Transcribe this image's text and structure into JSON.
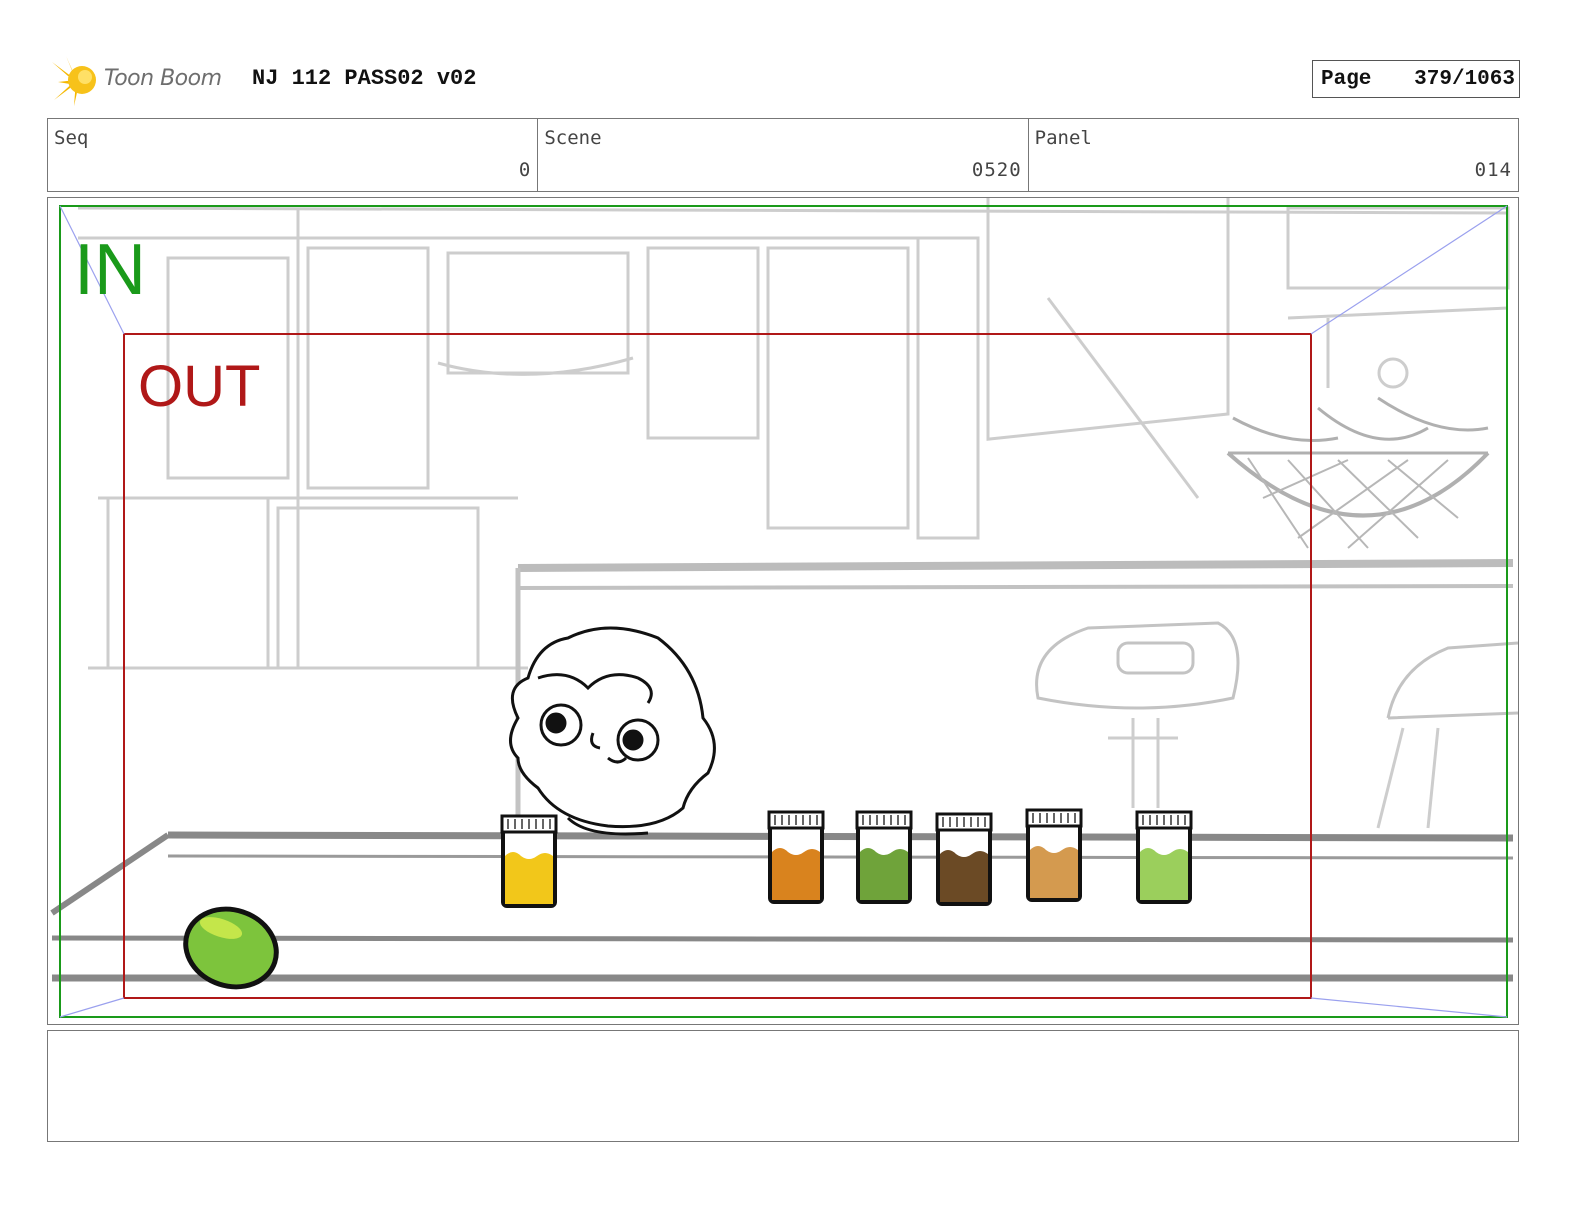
{
  "header": {
    "logo_text": "Toon Boom",
    "title": "NJ 112 PASS02 v02",
    "page_label": "Page",
    "page_value": "379/1063"
  },
  "info": {
    "seq_label": "Seq",
    "seq_value": "0",
    "scene_label": "Scene",
    "scene_value": "0520",
    "panel_label": "Panel",
    "panel_value": "014"
  },
  "frame": {
    "in_label": "IN",
    "out_label": "OUT",
    "in_color": "#1a9a1a",
    "out_color": "#b01818"
  },
  "jars": [
    {
      "name": "jar-yellow",
      "color": "#f2c71a"
    },
    {
      "name": "jar-orange",
      "color": "#d9831e"
    },
    {
      "name": "jar-green",
      "color": "#6fa33a"
    },
    {
      "name": "jar-brown",
      "color": "#6b4a25"
    },
    {
      "name": "jar-tan",
      "color": "#d49a4f"
    },
    {
      "name": "jar-lightgreen",
      "color": "#9bcf5c"
    }
  ],
  "notes": {
    "text": ""
  }
}
